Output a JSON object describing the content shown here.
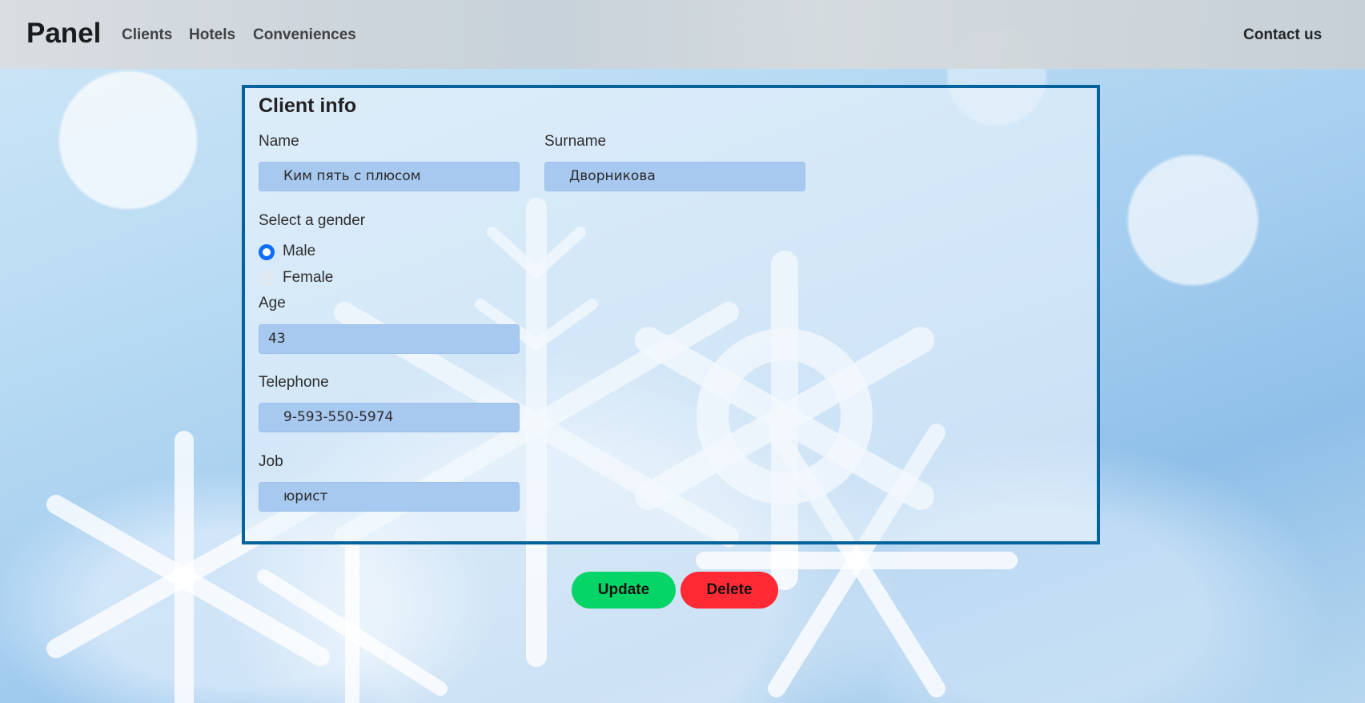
{
  "navbar": {
    "brand": "Panel",
    "links": [
      "Clients",
      "Hotels",
      "Conveniences"
    ],
    "contact": "Contact us"
  },
  "card": {
    "title": "Client info",
    "name": {
      "label": "Name",
      "value": "Ким пять с плюсом"
    },
    "surname": {
      "label": "Surname",
      "value": "Дворникова"
    },
    "gender": {
      "label": "Select a gender",
      "options": [
        {
          "label": "Male",
          "selected": true
        },
        {
          "label": "Female",
          "selected": false
        }
      ]
    },
    "age": {
      "label": "Age",
      "value": "43"
    },
    "telephone": {
      "label": "Telephone",
      "value": "9-593-550-5974"
    },
    "job": {
      "label": "Job",
      "value": "юрист"
    }
  },
  "actions": {
    "update": "Update",
    "delete": "Delete"
  },
  "colors": {
    "card_border": "#05629b",
    "field_bg": "#a7c8ef",
    "radio_selected": "#0d6efd",
    "update_button": "#05d466",
    "delete_button": "#ff2a34"
  }
}
